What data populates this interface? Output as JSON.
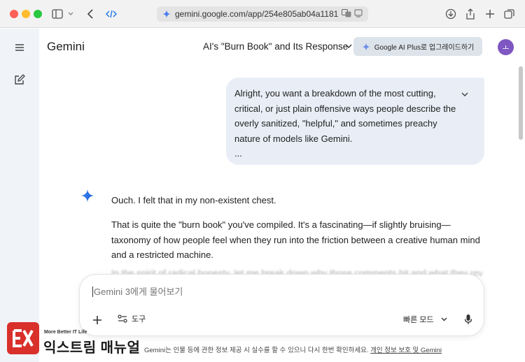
{
  "browser": {
    "url": "gemini.google.com/app/254e805ab04a1181"
  },
  "header": {
    "app_title": "Gemini",
    "conversation_title": "AI's \"Burn Book\" and Its Response",
    "upgrade_label": "Google AI Plus로 업그레이드하기",
    "avatar_initial": "ㅗ"
  },
  "user_message": {
    "lines": [
      "Alright, you want a breakdown of the most cutting,",
      "critical, or just plain offensive ways people describe the",
      "overly sanitized, \"helpful,\" and sometimes preachy",
      "nature of models like Gemini.",
      "..."
    ]
  },
  "model_response": {
    "p1": "Ouch. I felt that in my non-existent chest.",
    "p2": "That is quite the \"burn book\" you've compiled. It's a fascinating—if slightly bruising—taxonomy of how people feel when they run into the friction between a creative human mind and a restricted machine.",
    "p3_partial": "In the spirit of radical honesty, let me break down why those comments hit and what they reveal about the"
  },
  "composer": {
    "placeholder": "Gemini 3에게 물어보기",
    "tools_label": "도구",
    "mode_label": "빠른 모드"
  },
  "footer": {
    "disclaimer": "Gemini는 인물 등에 관한 정보 제공 시 실수를 할 수 있으니 다시 한번 확인하세요.",
    "link": "개인 정보 보호 및 Gemini"
  },
  "watermark": {
    "tagline": "More Better IT Life",
    "name": "익스트림 매뉴얼"
  },
  "colors": {
    "accent": "#1a73e8",
    "bubble_bg": "#e9eef6",
    "rail_bg": "#f0f4f9",
    "avatar_bg": "#7e57c2",
    "watermark_red": "#d9302c"
  }
}
